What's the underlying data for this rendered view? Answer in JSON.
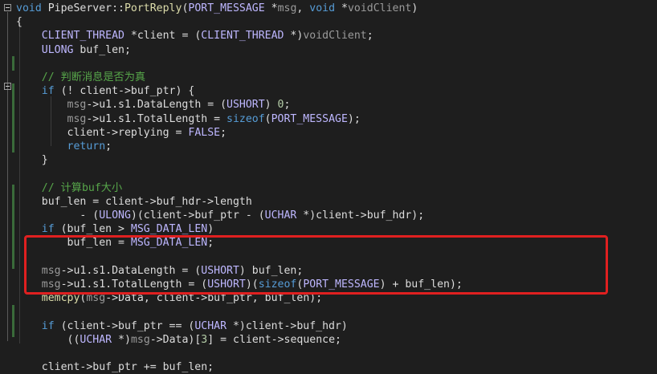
{
  "editor": {
    "lines": [
      {
        "tokens": [
          {
            "t": "void",
            "c": "kw"
          },
          {
            "t": " PipeServer::",
            "c": "var"
          },
          {
            "t": "PortReply",
            "c": "fn"
          },
          {
            "t": "(",
            "c": "var"
          },
          {
            "t": "PORT_MESSAGE",
            "c": "macro"
          },
          {
            "t": " *",
            "c": "var"
          },
          {
            "t": "msg",
            "c": "prm"
          },
          {
            "t": ", ",
            "c": "var"
          },
          {
            "t": "void",
            "c": "kw"
          },
          {
            "t": " *",
            "c": "var"
          },
          {
            "t": "voidClient",
            "c": "prm"
          },
          {
            "t": ")",
            "c": "var"
          }
        ]
      },
      {
        "tokens": [
          {
            "t": "{",
            "c": "var"
          }
        ]
      },
      {
        "tokens": [
          {
            "t": "    CLIENT_THREAD",
            "c": "macro"
          },
          {
            "t": " *client = (",
            "c": "var"
          },
          {
            "t": "CLIENT_THREAD",
            "c": "macro"
          },
          {
            "t": " *)",
            "c": "var"
          },
          {
            "t": "voidClient",
            "c": "prm"
          },
          {
            "t": ";",
            "c": "var"
          }
        ]
      },
      {
        "tokens": [
          {
            "t": "    ULONG",
            "c": "macro"
          },
          {
            "t": " buf_len;",
            "c": "var"
          }
        ]
      },
      {
        "tokens": [
          {
            "t": "",
            "c": "var"
          }
        ]
      },
      {
        "tokens": [
          {
            "t": "    // 判断消息是否为真",
            "c": "cm"
          }
        ]
      },
      {
        "tokens": [
          {
            "t": "    if",
            "c": "kw"
          },
          {
            "t": " (! client->buf_ptr) {",
            "c": "var"
          }
        ]
      },
      {
        "tokens": [
          {
            "t": "        msg",
            "c": "prm"
          },
          {
            "t": "->u1.s1.DataLength = (",
            "c": "var"
          },
          {
            "t": "USHORT",
            "c": "macro"
          },
          {
            "t": ") ",
            "c": "var"
          },
          {
            "t": "0",
            "c": "num"
          },
          {
            "t": ";",
            "c": "var"
          }
        ]
      },
      {
        "tokens": [
          {
            "t": "        msg",
            "c": "prm"
          },
          {
            "t": "->u1.s1.TotalLength = ",
            "c": "var"
          },
          {
            "t": "sizeof",
            "c": "kw"
          },
          {
            "t": "(",
            "c": "var"
          },
          {
            "t": "PORT_MESSAGE",
            "c": "macro"
          },
          {
            "t": ");",
            "c": "var"
          }
        ]
      },
      {
        "tokens": [
          {
            "t": "        client->replying = ",
            "c": "var"
          },
          {
            "t": "FALSE",
            "c": "macro"
          },
          {
            "t": ";",
            "c": "var"
          }
        ]
      },
      {
        "tokens": [
          {
            "t": "        return",
            "c": "kw"
          },
          {
            "t": ";",
            "c": "var"
          }
        ]
      },
      {
        "tokens": [
          {
            "t": "    }",
            "c": "var"
          }
        ]
      },
      {
        "tokens": [
          {
            "t": "",
            "c": "var"
          }
        ]
      },
      {
        "tokens": [
          {
            "t": "    // 计算buf大小",
            "c": "cm"
          }
        ]
      },
      {
        "tokens": [
          {
            "t": "    buf_len = client->buf_hdr->length",
            "c": "var"
          }
        ]
      },
      {
        "tokens": [
          {
            "t": "          - (",
            "c": "var"
          },
          {
            "t": "ULONG",
            "c": "macro"
          },
          {
            "t": ")(client->buf_ptr - (",
            "c": "var"
          },
          {
            "t": "UCHAR",
            "c": "macro"
          },
          {
            "t": " *)client->buf_hdr);",
            "c": "var"
          }
        ]
      },
      {
        "tokens": [
          {
            "t": "    if",
            "c": "kw"
          },
          {
            "t": " (buf_len > ",
            "c": "var"
          },
          {
            "t": "MSG_DATA_LEN",
            "c": "macro"
          },
          {
            "t": ")",
            "c": "var"
          }
        ]
      },
      {
        "tokens": [
          {
            "t": "        buf_len = ",
            "c": "var"
          },
          {
            "t": "MSG_DATA_LEN",
            "c": "macro"
          },
          {
            "t": ";",
            "c": "var"
          }
        ]
      },
      {
        "tokens": [
          {
            "t": "",
            "c": "var"
          }
        ]
      },
      {
        "tokens": [
          {
            "t": "    msg",
            "c": "prm"
          },
          {
            "t": "->u1.s1.DataLength = (",
            "c": "var"
          },
          {
            "t": "USHORT",
            "c": "macro"
          },
          {
            "t": ") buf_len;",
            "c": "var"
          }
        ]
      },
      {
        "tokens": [
          {
            "t": "    msg",
            "c": "prm"
          },
          {
            "t": "->u1.s1.TotalLength = (",
            "c": "var"
          },
          {
            "t": "USHORT",
            "c": "macro"
          },
          {
            "t": ")(",
            "c": "var"
          },
          {
            "t": "sizeof",
            "c": "kw"
          },
          {
            "t": "(",
            "c": "var"
          },
          {
            "t": "PORT_MESSAGE",
            "c": "macro"
          },
          {
            "t": ") + buf_len);",
            "c": "var"
          }
        ]
      },
      {
        "tokens": [
          {
            "t": "    memcpy",
            "c": "fn"
          },
          {
            "t": "(",
            "c": "var"
          },
          {
            "t": "msg",
            "c": "prm"
          },
          {
            "t": "->Data, client->buf_ptr, buf_len);",
            "c": "var"
          }
        ]
      },
      {
        "tokens": [
          {
            "t": "",
            "c": "var"
          }
        ]
      },
      {
        "tokens": [
          {
            "t": "    if",
            "c": "kw"
          },
          {
            "t": " (client->buf_ptr == (",
            "c": "var"
          },
          {
            "t": "UCHAR",
            "c": "macro"
          },
          {
            "t": " *)client->buf_hdr)",
            "c": "var"
          }
        ]
      },
      {
        "tokens": [
          {
            "t": "        ((",
            "c": "var"
          },
          {
            "t": "UCHAR",
            "c": "macro"
          },
          {
            "t": " *)",
            "c": "var"
          },
          {
            "t": "msg",
            "c": "prm"
          },
          {
            "t": "->Data)[",
            "c": "var"
          },
          {
            "t": "3",
            "c": "num"
          },
          {
            "t": "] = client->sequence;",
            "c": "var"
          }
        ]
      },
      {
        "tokens": [
          {
            "t": "",
            "c": "var"
          }
        ]
      },
      {
        "tokens": [
          {
            "t": "    client->buf_ptr += buf_len;",
            "c": "var"
          }
        ]
      }
    ]
  }
}
